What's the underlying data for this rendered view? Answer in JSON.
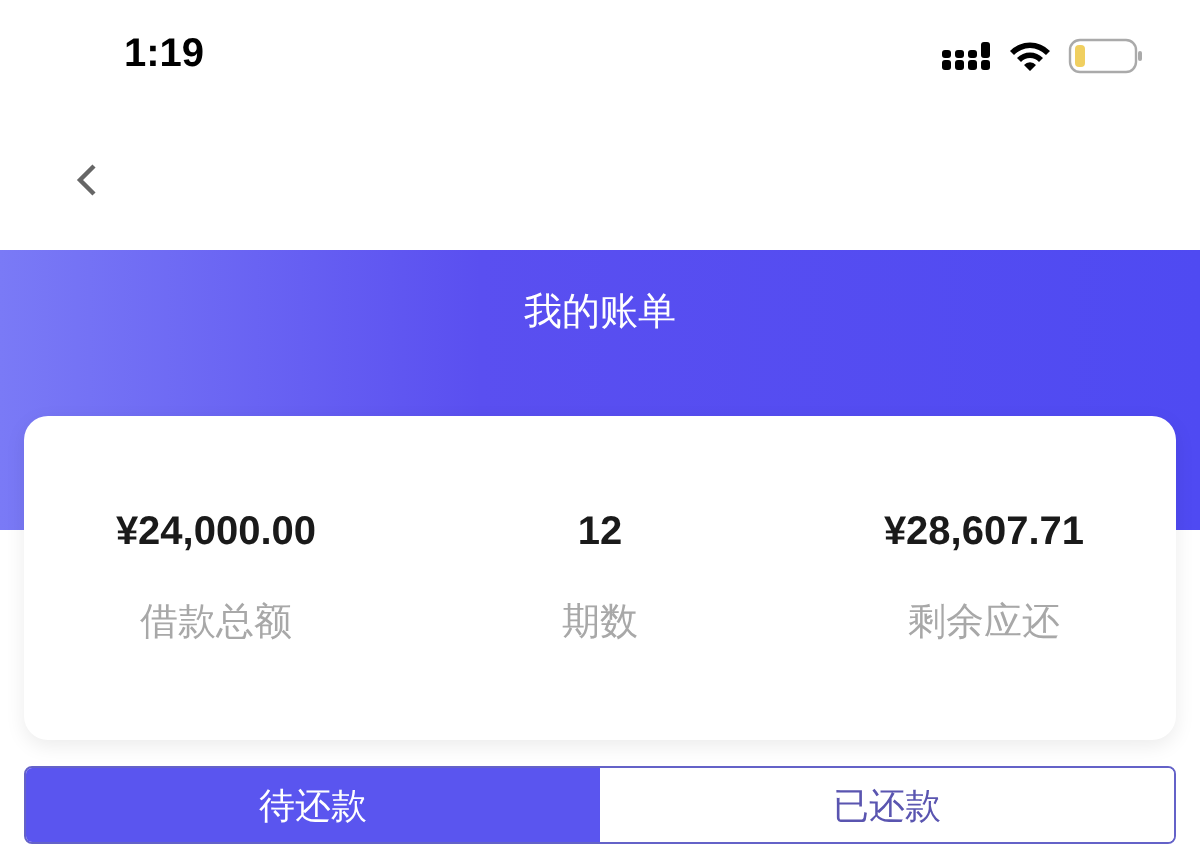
{
  "status_bar": {
    "time": "1:19"
  },
  "header": {
    "title": "我的账单"
  },
  "summary": [
    {
      "value": "¥24,000.00",
      "label": "借款总额"
    },
    {
      "value": "12",
      "label": "期数"
    },
    {
      "value": "¥28,607.71",
      "label": "剩余应还"
    }
  ],
  "tabs": [
    {
      "label": "待还款",
      "selected": true
    },
    {
      "label": "已还款",
      "selected": false
    }
  ]
}
